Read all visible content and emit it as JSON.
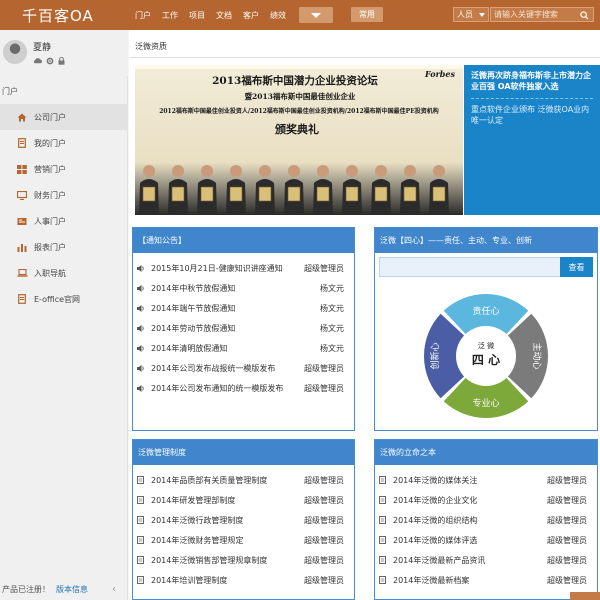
{
  "app": {
    "logo": "千百客OA"
  },
  "nav": {
    "items": [
      "门户",
      "工作",
      "项目",
      "文档",
      "客户",
      "绩效"
    ],
    "common_label": "常用"
  },
  "search": {
    "type": "人员",
    "placeholder": "请输入关键字搜索"
  },
  "user": {
    "name": "夏静"
  },
  "sidebar": {
    "section_title": "门户",
    "items": [
      {
        "label": "公司门户",
        "icon": "home-icon",
        "active": true
      },
      {
        "label": "我的门户",
        "icon": "document-icon"
      },
      {
        "label": "营销门户",
        "icon": "grid-icon"
      },
      {
        "label": "财务门户",
        "icon": "monitor-icon"
      },
      {
        "label": "人事门户",
        "icon": "people-icon"
      },
      {
        "label": "报表门户",
        "icon": "bar-chart-icon"
      },
      {
        "label": "入职导航",
        "icon": "laptop-icon"
      },
      {
        "label": "E-office官网",
        "icon": "document-icon"
      }
    ],
    "footer": {
      "registered": "产品已注册！",
      "version": "版本信息"
    }
  },
  "page": {
    "title": "泛微资质"
  },
  "banner": {
    "line1": "2013福布斯中国潜力企业投资论坛",
    "line2": "暨2013福布斯中国最佳创业企业",
    "line3": "2012福布斯中国最佳创业投资人/2012福布斯中国最佳创业投资机构/2012福布斯中国最佳PE投资机构",
    "line4": "颁奖典礼",
    "brand": "Forbes",
    "caption_main": "泛微再次跻身福布斯非上市潜力企业百强 OA软件独家入选",
    "caption_sub": "重点软件企业颁布 泛微获OA业内唯一认定"
  },
  "notice": {
    "title": "【通知公告】",
    "rows": [
      {
        "text": "2015年10月21日-健康知识讲座通知",
        "author": "超级管理员"
      },
      {
        "text": "2014年中秋节放假通知",
        "author": "杨文元"
      },
      {
        "text": "2014年端午节放假通知",
        "author": "杨文元"
      },
      {
        "text": "2014年劳动节放假通知",
        "author": "杨文元"
      },
      {
        "text": "2014年清明放假通知",
        "author": "杨文元"
      },
      {
        "text": "2014年公司发布战报统一模版发布",
        "author": "超级管理员"
      },
      {
        "text": "2014年公司发布通知的统一模版发布",
        "author": "超级管理员"
      }
    ]
  },
  "four_heart": {
    "title": "泛微【四心】——责任、主动、专业、创新",
    "search_label": "查看",
    "center_top": "泛 微",
    "center_main": "四 心",
    "segments": {
      "top": "责任心",
      "right": "主动心",
      "bottom": "专业心",
      "left": "创新心"
    },
    "colors": {
      "top": "#5bb7dd",
      "right": "#7b7b7b",
      "bottom": "#7da83a",
      "left": "#4b5da4"
    }
  },
  "rules": {
    "title": "泛微管理制度",
    "rows": [
      {
        "text": "2014年品质部有关质量管理制度",
        "author": "超级管理员"
      },
      {
        "text": "2014年研发管理部制度",
        "author": "超级管理员"
      },
      {
        "text": "2014年泛微行政管理制度",
        "author": "超级管理员"
      },
      {
        "text": "2014年泛微财务管理规定",
        "author": "超级管理员"
      },
      {
        "text": "2014年泛微销售部管理规章制度",
        "author": "超级管理员"
      },
      {
        "text": "2014年培训管理制度",
        "author": "超级管理员"
      }
    ]
  },
  "foundation": {
    "title": "泛微的立命之本",
    "rows": [
      {
        "text": "2014年泛微的媒体关注",
        "author": "超级管理员"
      },
      {
        "text": "2014年泛微的企业文化",
        "author": "超级管理员"
      },
      {
        "text": "2014年泛微的组织结构",
        "author": "超级管理员"
      },
      {
        "text": "2014年泛微的媒体评选",
        "author": "超级管理员"
      },
      {
        "text": "2014年泛微最新产品资讯",
        "author": "超级管理员"
      },
      {
        "text": "2014年泛微最新档案",
        "author": "超级管理员"
      }
    ]
  }
}
